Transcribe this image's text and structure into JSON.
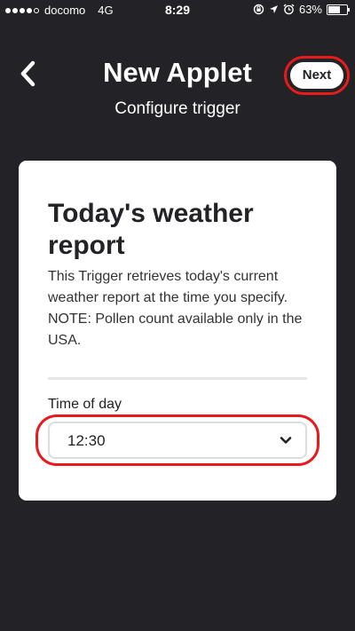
{
  "status_bar": {
    "carrier": "docomo",
    "network": "4G",
    "time": "8:29",
    "battery_percent": "63%",
    "battery_level": 0.63,
    "signal_bars_filled": 4,
    "signal_bars_total": 5
  },
  "header": {
    "title": "New Applet",
    "subtitle": "Configure trigger",
    "next_label": "Next"
  },
  "card": {
    "title": "Today's weather report",
    "description": "This Trigger retrieves today's current weather report at the time you specify. NOTE: Pollen count available only in the USA.",
    "field_label": "Time of day",
    "time_value": "12:30"
  },
  "colors": {
    "background": "#222227",
    "card": "#ffffff",
    "highlight_ring": "#e81b1b"
  }
}
